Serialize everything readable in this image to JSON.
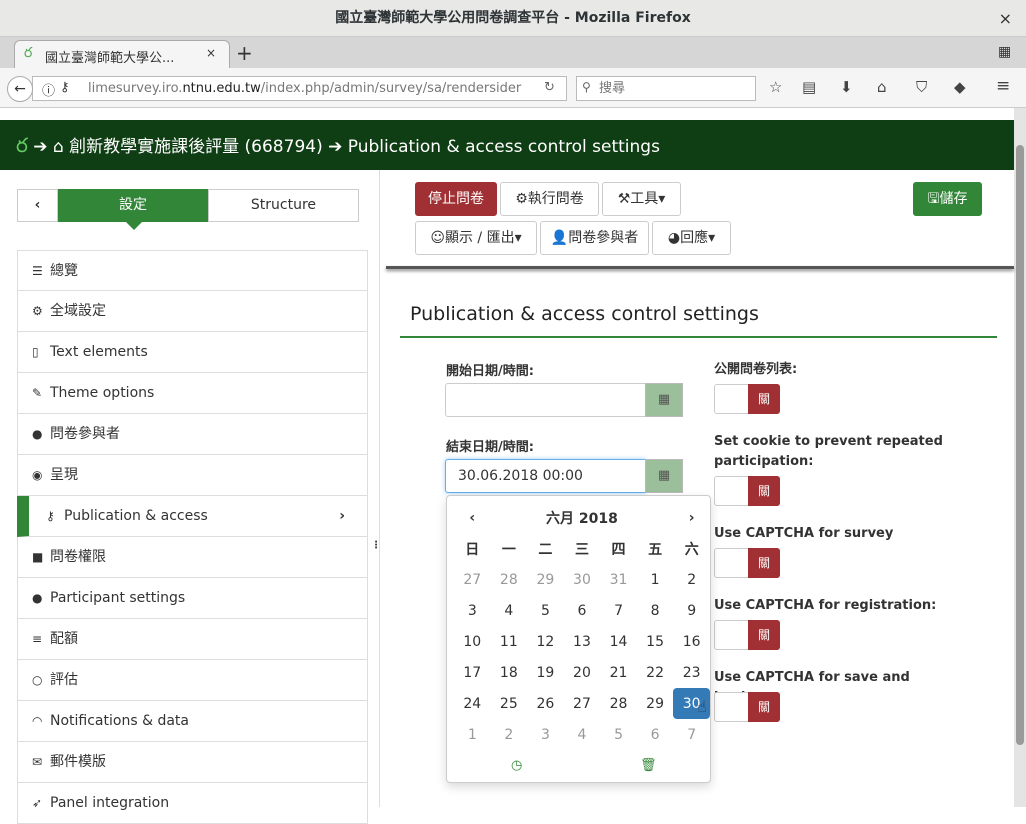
{
  "window": {
    "title": "國立臺灣師範大學公用問卷調查平台 - Mozilla Firefox",
    "close": "×"
  },
  "browser": {
    "tab_label": "國立臺灣師範大學公...",
    "tab_close": "×",
    "new_tab": "+",
    "url_prefix": "limesurvey.iro.",
    "url_domain": "ntnu.edu.tw",
    "url_path": "/index.php/admin/survey/sa/rendersider",
    "search_placeholder": "搜尋"
  },
  "breadcrumb": {
    "survey": "創新教學實施課後評量 (668794)",
    "page": "Publication & access control settings"
  },
  "sidebar": {
    "tab_settings": "設定",
    "tab_structure": "Structure",
    "items": [
      {
        "label": "總覽",
        "icon": "list-icon"
      },
      {
        "label": "全域設定",
        "icon": "cogs-icon"
      },
      {
        "label": "Text elements",
        "icon": "file-text-icon"
      },
      {
        "label": "Theme options",
        "icon": "paintbrush-icon"
      },
      {
        "label": "問卷參與者",
        "icon": "user-icon"
      },
      {
        "label": "呈現",
        "icon": "eye-slash-icon"
      },
      {
        "label": "Publication & access",
        "icon": "key-icon",
        "active": true
      },
      {
        "label": "問卷權限",
        "icon": "lock-icon"
      },
      {
        "label": "Participant settings",
        "icon": "users-icon"
      },
      {
        "label": "配額",
        "icon": "tasks-icon"
      },
      {
        "label": "評估",
        "icon": "comment-icon"
      },
      {
        "label": "Notifications & data",
        "icon": "rss-icon"
      },
      {
        "label": "郵件模版",
        "icon": "envelope-icon"
      },
      {
        "label": "Panel integration",
        "icon": "rocket-icon"
      }
    ]
  },
  "toolbar": {
    "stop": "停止問卷",
    "run": "執行問卷",
    "tools": "工具",
    "display": "顯示 / 匯出",
    "participants": "問卷參與者",
    "responses": "回應",
    "save": "儲存"
  },
  "form": {
    "title": "Publication & access control settings",
    "start_label": "開始日期/時間:",
    "start_value": "",
    "end_label": "結束日期/時間:",
    "end_value": "30.06.2018 00:00",
    "toggles": [
      {
        "label": "公開問卷列表:",
        "state": "關"
      },
      {
        "label": "Set cookie to prevent repeated participation:",
        "state": "關"
      },
      {
        "label": "Use CAPTCHA for survey access:",
        "state": "關"
      },
      {
        "label": "Use CAPTCHA for registration:",
        "state": "關"
      },
      {
        "label": "Use CAPTCHA for save and load:",
        "state": "關"
      }
    ]
  },
  "calendar": {
    "month": "六月 2018",
    "weekdays": [
      "日",
      "一",
      "二",
      "三",
      "四",
      "五",
      "六"
    ],
    "weeks": [
      [
        "27",
        "28",
        "29",
        "30",
        "31",
        "1",
        "2"
      ],
      [
        "3",
        "4",
        "5",
        "6",
        "7",
        "8",
        "9"
      ],
      [
        "10",
        "11",
        "12",
        "13",
        "14",
        "15",
        "16"
      ],
      [
        "17",
        "18",
        "19",
        "20",
        "21",
        "22",
        "23"
      ],
      [
        "24",
        "25",
        "26",
        "27",
        "28",
        "29",
        "30"
      ],
      [
        "1",
        "2",
        "3",
        "4",
        "5",
        "6",
        "7"
      ]
    ],
    "selected": "30"
  },
  "colors": {
    "brand_green": "#328637",
    "header_green": "#0f3d14",
    "danger": "#a03033",
    "selected": "#337ab7"
  }
}
